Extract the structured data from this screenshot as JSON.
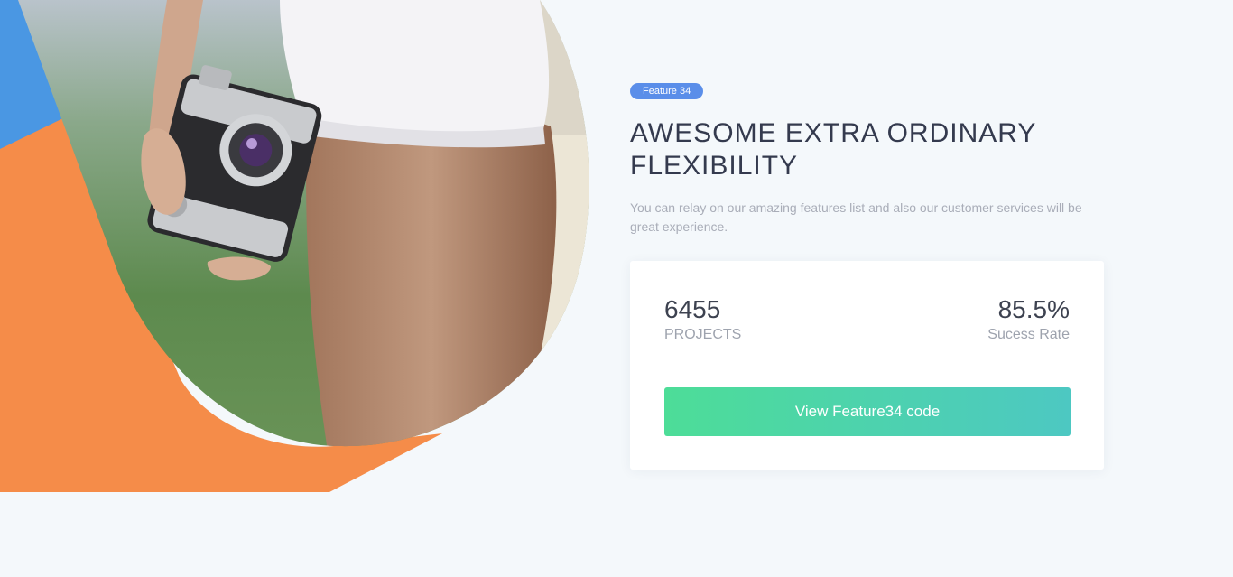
{
  "feature": {
    "badge": "Feature 34",
    "title": "AWESOME EXTRA ORDINARY FLEXIBILITY",
    "description": "You can relay on our amazing features list and also our customer services will be great experience."
  },
  "stats": [
    {
      "value": "6455",
      "label": "PROJECTS"
    },
    {
      "value": "85.5%",
      "label": "Sucess Rate"
    }
  ],
  "cta": {
    "label": "View Feature34 code"
  },
  "colors": {
    "accent_blue": "#5a8ee9",
    "shape_blue": "#4a97e3",
    "shape_orange": "#f58c49",
    "cta_start": "#4ddd98",
    "cta_end": "#4dc8c2"
  },
  "hero_image": {
    "icon": "camera-photo"
  }
}
